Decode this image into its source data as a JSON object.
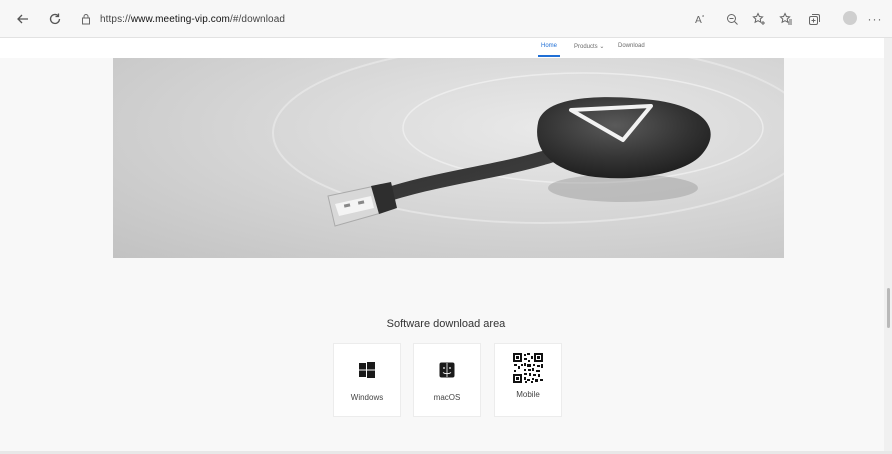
{
  "browser": {
    "url_prefix": "https://",
    "url_host": "www.meeting-vip.com",
    "url_path": "/#/download",
    "icons": [
      "back-icon",
      "refresh-icon",
      "lock-icon",
      "read-aloud-icon",
      "zoom-icon",
      "add-favorite-icon",
      "favorites-icon",
      "collections-icon",
      "profile-icon",
      "more-icon"
    ]
  },
  "site_nav": {
    "items": [
      {
        "label": "Home",
        "active": true
      },
      {
        "label": "Products ⌄",
        "active": false
      },
      {
        "label": "Download",
        "active": false
      }
    ],
    "accent": "#1f6fd6"
  },
  "hero": {
    "image": "usb-dongle-photo"
  },
  "download": {
    "title": "Software download area",
    "cards": [
      {
        "label": "Windows",
        "icon": "windows-icon"
      },
      {
        "label": "macOS",
        "icon": "macos-finder-icon"
      },
      {
        "label": "Mobile",
        "icon": "qr-code-icon"
      }
    ]
  }
}
